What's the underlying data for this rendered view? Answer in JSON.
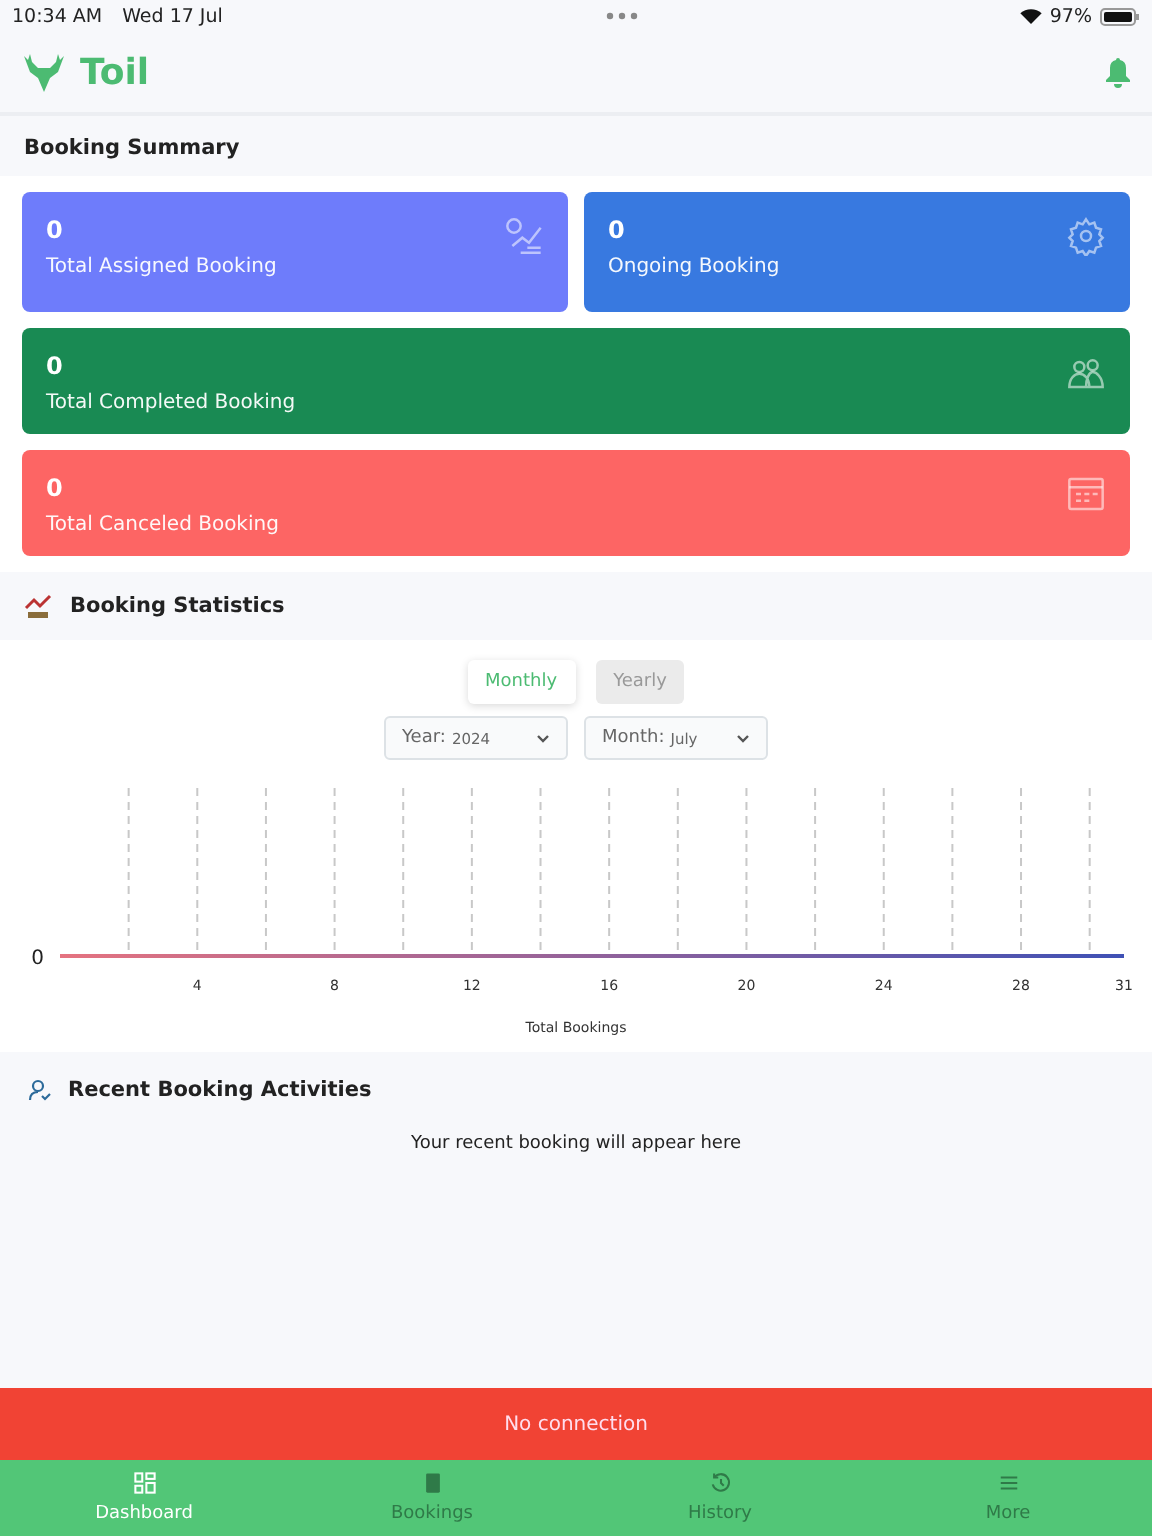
{
  "status_bar": {
    "time": "10:34 AM",
    "date": "Wed 17 Jul",
    "battery": "97%"
  },
  "header": {
    "title": "Toil"
  },
  "summary": {
    "title": "Booking Summary",
    "cards": [
      {
        "value": "0",
        "label": "Total Assigned Booking",
        "color": "#6e7cfb",
        "kind": "half"
      },
      {
        "value": "0",
        "label": "Ongoing Booking",
        "color": "#3879e0",
        "kind": "half"
      },
      {
        "value": "0",
        "label": "Total Completed Booking",
        "color": "#198a53",
        "kind": "wide"
      },
      {
        "value": "0",
        "label": "Total Canceled Booking",
        "color": "#fd6564",
        "kind": "wide"
      }
    ]
  },
  "statistics": {
    "title": "Booking Statistics",
    "toggle": [
      {
        "label": "Monthly",
        "selected": true
      },
      {
        "label": "Yearly",
        "selected": false
      }
    ],
    "filters": [
      {
        "label": "Year:",
        "value": "2024"
      },
      {
        "label": "Month:",
        "value": "July"
      }
    ],
    "chart": {
      "y_axis_label": "0",
      "x_axis_labels": [
        "4",
        "8",
        "12",
        "16",
        "20",
        "24",
        "28",
        "31"
      ],
      "legend": "Total Bookings"
    }
  },
  "recent": {
    "title": "Recent Booking Activities",
    "empty_text": "Your recent booking will appear here"
  },
  "banner": {
    "text": "No connection"
  },
  "tabs": [
    {
      "label": "Dashboard",
      "selected": true
    },
    {
      "label": "Bookings",
      "selected": false
    },
    {
      "label": "History",
      "selected": false
    },
    {
      "label": "More",
      "selected": false
    }
  ]
}
